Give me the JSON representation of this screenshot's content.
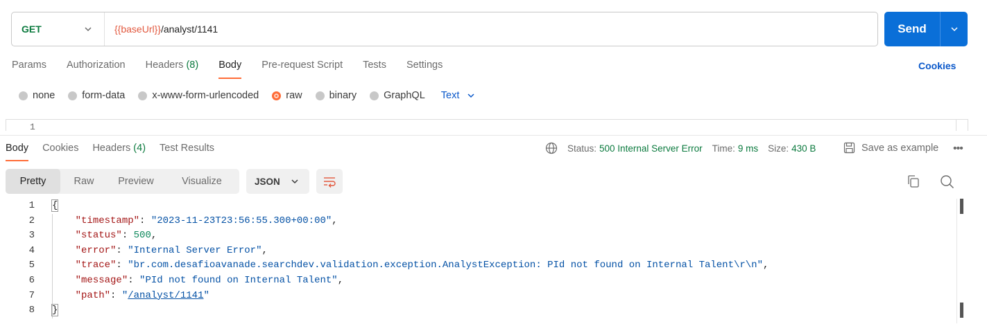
{
  "request": {
    "method": "GET",
    "url_var": "{{baseUrl}}",
    "url_path": "/analyst/1141",
    "send_label": "Send"
  },
  "req_tabs": [
    {
      "label": "Params",
      "count": ""
    },
    {
      "label": "Authorization",
      "count": ""
    },
    {
      "label": "Headers",
      "count": "(8)"
    },
    {
      "label": "Body",
      "count": ""
    },
    {
      "label": "Pre-request Script",
      "count": ""
    },
    {
      "label": "Tests",
      "count": ""
    },
    {
      "label": "Settings",
      "count": ""
    }
  ],
  "req_tabs_active": "Body",
  "cookies_label": "Cookies",
  "body_types": [
    "none",
    "form-data",
    "x-www-form-urlencoded",
    "raw",
    "binary",
    "GraphQL"
  ],
  "body_type_selected": "raw",
  "raw_format": "Text",
  "editor_line": "1",
  "res_tabs": [
    {
      "label": "Body",
      "count": ""
    },
    {
      "label": "Cookies",
      "count": ""
    },
    {
      "label": "Headers",
      "count": "(4)"
    },
    {
      "label": "Test Results",
      "count": ""
    }
  ],
  "response": {
    "status_label": "Status:",
    "status_value": "500 Internal Server Error",
    "time_label": "Time:",
    "time_value": "9 ms",
    "size_label": "Size:",
    "size_value": "430 B",
    "save_label": "Save as example"
  },
  "view_modes": [
    "Pretty",
    "Raw",
    "Preview",
    "Visualize"
  ],
  "view_mode_active": "Pretty",
  "format": "JSON",
  "code_lines": [
    {
      "n": "1",
      "parts": [
        [
          "brace",
          "{"
        ]
      ]
    },
    {
      "n": "2",
      "parts": [
        [
          "pun",
          "    "
        ],
        [
          "key",
          "\"timestamp\""
        ],
        [
          "pun",
          ": "
        ],
        [
          "str",
          "\"2023-11-23T23:56:55.300+00:00\""
        ],
        [
          "pun",
          ","
        ]
      ]
    },
    {
      "n": "3",
      "parts": [
        [
          "pun",
          "    "
        ],
        [
          "key",
          "\"status\""
        ],
        [
          "pun",
          ": "
        ],
        [
          "num-v",
          "500"
        ],
        [
          "pun",
          ","
        ]
      ]
    },
    {
      "n": "4",
      "parts": [
        [
          "pun",
          "    "
        ],
        [
          "key",
          "\"error\""
        ],
        [
          "pun",
          ": "
        ],
        [
          "str",
          "\"Internal Server Error\""
        ],
        [
          "pun",
          ","
        ]
      ]
    },
    {
      "n": "5",
      "parts": [
        [
          "pun",
          "    "
        ],
        [
          "key",
          "\"trace\""
        ],
        [
          "pun",
          ": "
        ],
        [
          "str",
          "\"br.com.desafioavanade.searchdev.validation.exception.AnalystException: PId not found on Internal Talent\\r\\n\""
        ],
        [
          "pun",
          ","
        ]
      ]
    },
    {
      "n": "6",
      "parts": [
        [
          "pun",
          "    "
        ],
        [
          "key",
          "\"message\""
        ],
        [
          "pun",
          ": "
        ],
        [
          "str",
          "\"PId not found on Internal Talent\""
        ],
        [
          "pun",
          ","
        ]
      ]
    },
    {
      "n": "7",
      "parts": [
        [
          "pun",
          "    "
        ],
        [
          "key",
          "\"path\""
        ],
        [
          "pun",
          ": "
        ],
        [
          "str",
          "\""
        ],
        [
          "str link",
          "/analyst/1141"
        ],
        [
          "str",
          "\""
        ]
      ]
    },
    {
      "n": "8",
      "parts": [
        [
          "brace",
          "}"
        ]
      ]
    }
  ],
  "colors": {
    "accent": "#ff6c37",
    "send_button": "#0a6fd8",
    "method_get": "#0b7a3e",
    "variable": "#e2583e",
    "link": "#0a58ca"
  }
}
